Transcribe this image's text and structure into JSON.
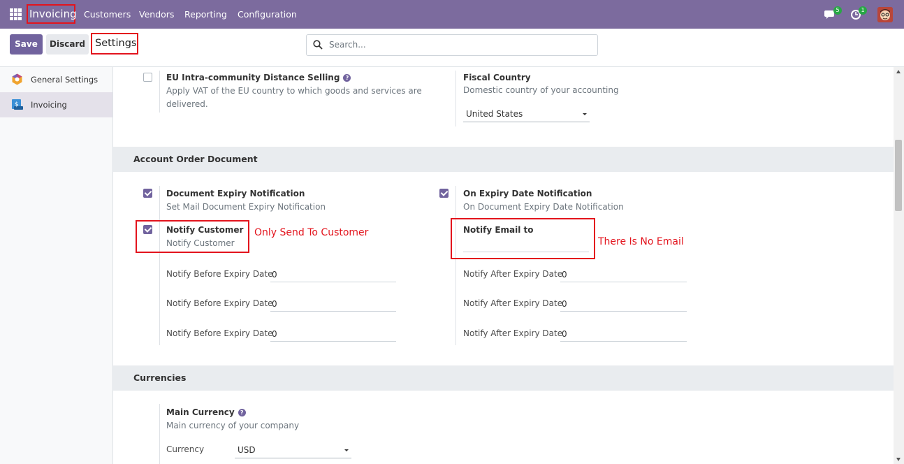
{
  "topbar": {
    "app_name": "Invoicing",
    "menu": [
      "Customers",
      "Vendors",
      "Reporting",
      "Configuration"
    ],
    "messages_count": "5",
    "activities_count": "1",
    "bg_color": "#7c6b9e"
  },
  "controlbar": {
    "save_label": "Save",
    "discard_label": "Discard",
    "title": "Settings",
    "search_placeholder": "Search..."
  },
  "sidebar": {
    "items": [
      {
        "label": "General Settings",
        "icon": "odoo-settings-icon"
      },
      {
        "label": "Invoicing",
        "icon": "invoicing-app-icon",
        "active": true
      }
    ]
  },
  "eu_section": {
    "eu_distance": {
      "label": "EU Intra-community Distance Selling",
      "help": "?",
      "description": "Apply VAT of the EU country to which goods and services are delivered.",
      "checked": false
    },
    "fiscal_country": {
      "label": "Fiscal Country",
      "description": "Domestic country of your accounting",
      "value": "United States"
    }
  },
  "account_order": {
    "title": "Account Order Document",
    "doc_expiry": {
      "label": "Document Expiry Notification",
      "description": "Set Mail Document Expiry Notification",
      "checked": true
    },
    "on_expiry": {
      "label": "On Expiry Date Notification",
      "description": "On Document Expiry Date Notification",
      "checked": true
    },
    "notify_customer": {
      "label": "Notify Customer",
      "description": "Notify Customer",
      "checked": true
    },
    "notify_email": {
      "label": "Notify Email to",
      "value": ""
    },
    "before_rows": [
      {
        "label": "Notify Before Expiry Date",
        "value": "0"
      },
      {
        "label": "Notify Before Expiry Date",
        "value": "0"
      },
      {
        "label": "Notify Before Expiry Date",
        "value": "0"
      }
    ],
    "after_rows": [
      {
        "label": "Notify After Expiry Date",
        "value": "0"
      },
      {
        "label": "Notify After Expiry Date",
        "value": "0"
      },
      {
        "label": "Notify After Expiry Date",
        "value": "0"
      }
    ]
  },
  "annotations": {
    "customer_note": "Only Send To Customer",
    "email_note": "There Is No Email"
  },
  "currencies": {
    "title": "Currencies",
    "main_currency": {
      "label": "Main Currency",
      "help": "?",
      "description": "Main currency of your company",
      "currency_label": "Currency",
      "currency_value": "USD"
    }
  }
}
